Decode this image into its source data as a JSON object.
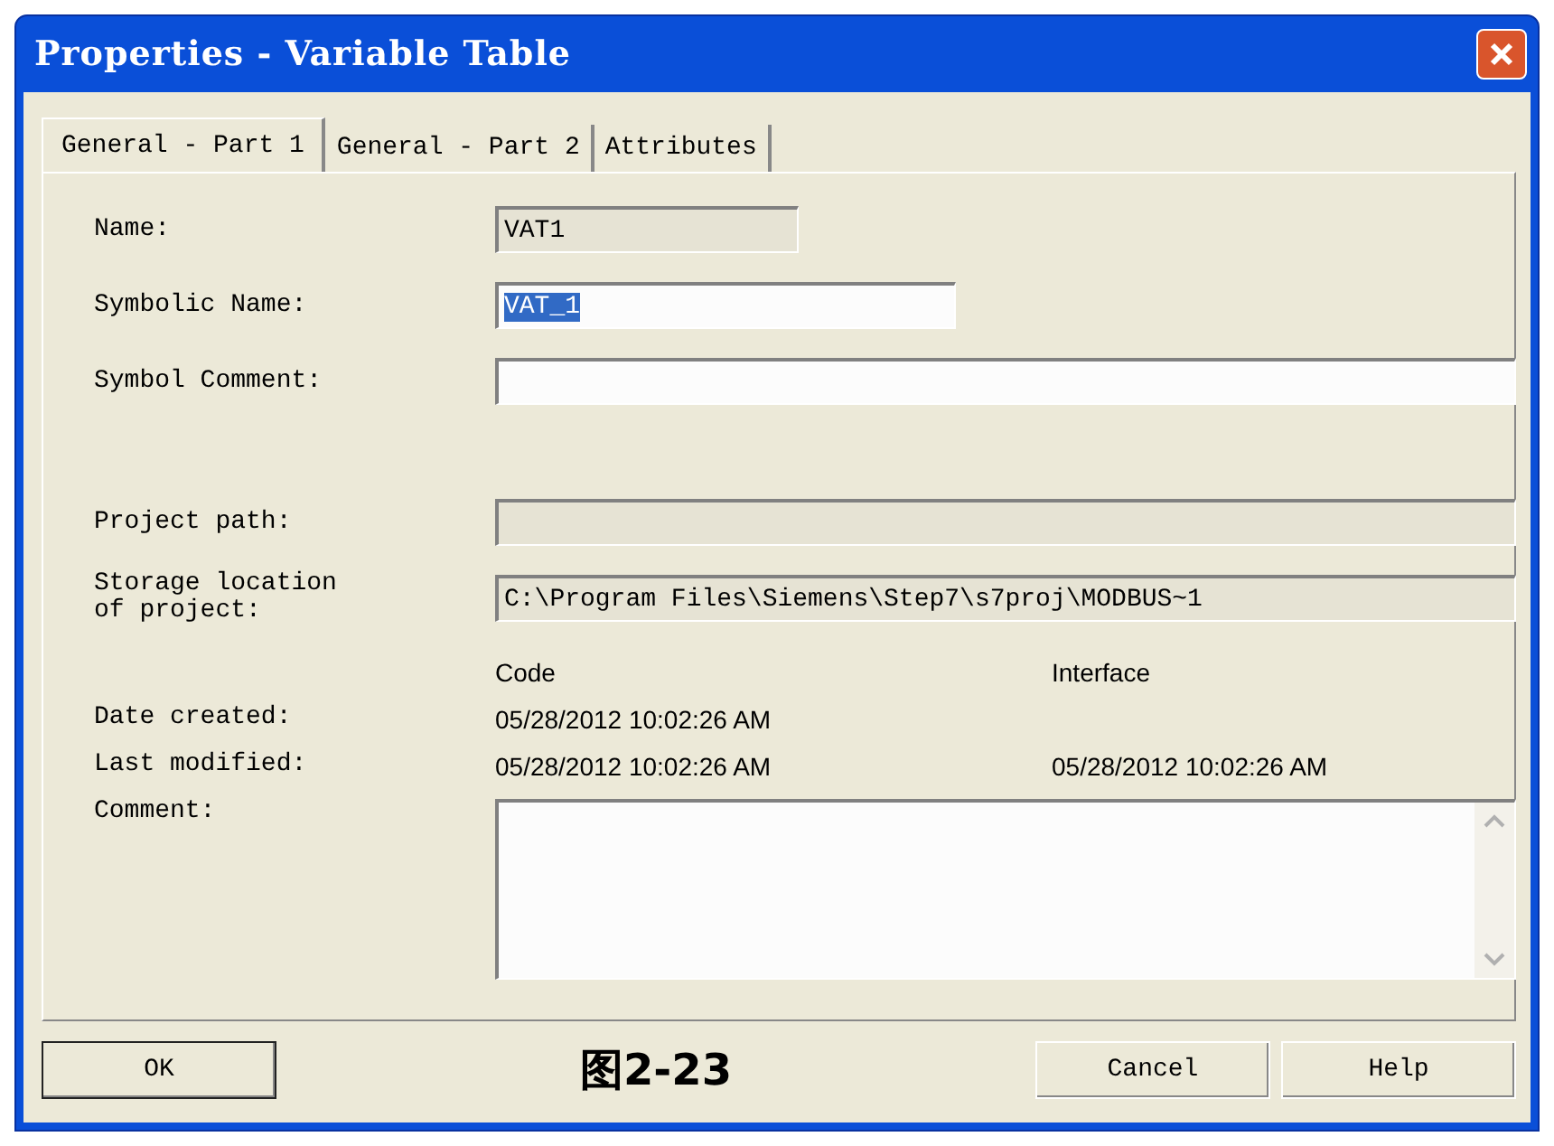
{
  "window": {
    "title": "Properties - Variable Table"
  },
  "tabs": [
    {
      "label": "General - Part 1",
      "selected": true
    },
    {
      "label": "General - Part 2",
      "selected": false
    },
    {
      "label": "Attributes",
      "selected": false
    }
  ],
  "fields": [
    {
      "label": "Name:",
      "value": "VAT1",
      "disabled": true,
      "text_selected": false
    },
    {
      "label": "Symbolic Name:",
      "value": "VAT_1",
      "disabled": false,
      "text_selected": true
    },
    {
      "label": "Symbol Comment:",
      "disabled": false
    }
  ],
  "paths": [
    {
      "label": "Project path:",
      "disabled": true
    },
    {
      "label": "Storage location\nof project:",
      "value": "C:\\Program Files\\Siemens\\Step7\\s7proj\\MODBUS~1",
      "disabled": true
    }
  ],
  "dates": {
    "columns": [
      "Code",
      "Interface"
    ],
    "rows": [
      {
        "label": "Date created:",
        "code": "05/28/2012 10:02:26 AM"
      },
      {
        "label": "Last modified:",
        "code": "05/28/2012 10:02:26 AM",
        "interface": "05/28/2012 10:02:26 AM"
      }
    ]
  },
  "comment": {
    "label": "Comment:"
  },
  "buttons": [
    {
      "label": "OK",
      "default": true
    },
    {
      "label": "Cancel",
      "default": false
    },
    {
      "label": "Help",
      "default": false
    }
  ],
  "figure_caption": "图2-23"
}
